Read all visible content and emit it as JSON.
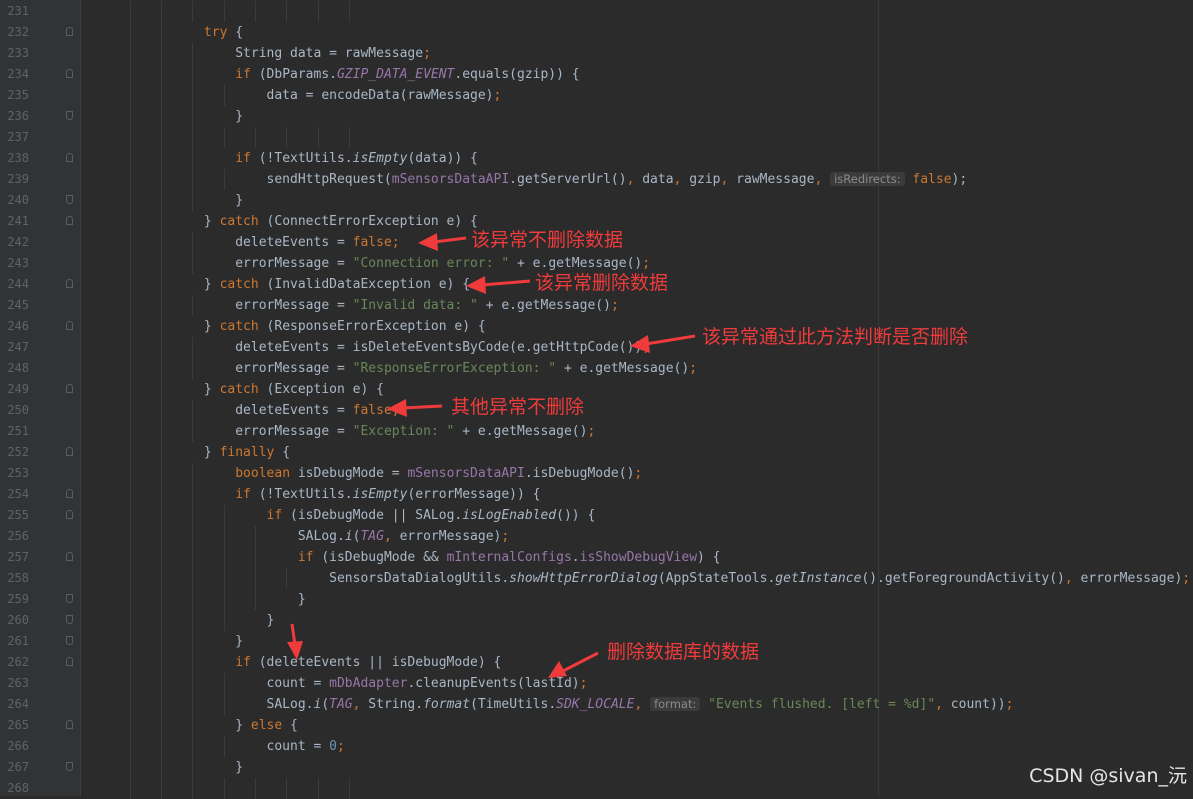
{
  "editor": {
    "lines": [
      {
        "n": "231",
        "fold": "",
        "segs": []
      },
      {
        "n": "232",
        "fold": "start",
        "segs": [
          [
            "            ",
            ""
          ],
          [
            "try",
            "kw"
          ],
          [
            " {",
            ""
          ]
        ]
      },
      {
        "n": "233",
        "fold": "",
        "segs": [
          [
            "                String data = rawMessage",
            ""
          ],
          [
            ";",
            "kw"
          ]
        ]
      },
      {
        "n": "234",
        "fold": "start",
        "segs": [
          [
            "                ",
            ""
          ],
          [
            "if",
            "kw"
          ],
          [
            " (DbParams.",
            ""
          ],
          [
            "GZIP_DATA_EVENT",
            "field ital"
          ],
          [
            ".equals(gzip)) {",
            ""
          ]
        ]
      },
      {
        "n": "235",
        "fold": "",
        "segs": [
          [
            "                    data = encodeData(rawMessage)",
            ""
          ],
          [
            ";",
            "kw"
          ]
        ]
      },
      {
        "n": "236",
        "fold": "end",
        "segs": [
          [
            "                }",
            ""
          ]
        ]
      },
      {
        "n": "237",
        "fold": "",
        "segs": []
      },
      {
        "n": "238",
        "fold": "start",
        "segs": [
          [
            "                ",
            ""
          ],
          [
            "if",
            "kw"
          ],
          [
            " (!TextUtils.",
            ""
          ],
          [
            "isEmpty",
            "ital"
          ],
          [
            "(data)) {",
            ""
          ]
        ]
      },
      {
        "n": "239",
        "fold": "",
        "segs": [
          [
            "                    sendHttpRequest(",
            ""
          ],
          [
            "mSensorsDataAPI",
            "field"
          ],
          [
            ".getServerUrl()",
            ""
          ],
          [
            ",",
            "kw"
          ],
          [
            " data",
            ""
          ],
          [
            ",",
            "kw"
          ],
          [
            " gzip",
            ""
          ],
          [
            ",",
            "kw"
          ],
          [
            " rawMessage",
            ""
          ],
          [
            ",",
            "kw"
          ],
          [
            " ",
            ""
          ],
          [
            "isRedirects:",
            "hint"
          ],
          [
            " ",
            ""
          ],
          [
            "false",
            "kw"
          ],
          [
            ");",
            ""
          ]
        ]
      },
      {
        "n": "240",
        "fold": "end",
        "segs": [
          [
            "                }",
            ""
          ]
        ]
      },
      {
        "n": "241",
        "fold": "start",
        "segs": [
          [
            "            } ",
            ""
          ],
          [
            "catch",
            "kw"
          ],
          [
            " (ConnectErrorException e) {",
            ""
          ]
        ]
      },
      {
        "n": "242",
        "fold": "",
        "segs": [
          [
            "                deleteEvents = ",
            ""
          ],
          [
            "false",
            "kw"
          ],
          [
            ";",
            "kw"
          ]
        ]
      },
      {
        "n": "243",
        "fold": "",
        "segs": [
          [
            "                errorMessage = ",
            ""
          ],
          [
            "\"Connection error: \"",
            "str"
          ],
          [
            " + e.getMessage()",
            ""
          ],
          [
            ";",
            "kw"
          ]
        ]
      },
      {
        "n": "244",
        "fold": "start",
        "segs": [
          [
            "            } ",
            ""
          ],
          [
            "catch",
            "kw"
          ],
          [
            " (InvalidDataException e) {",
            ""
          ]
        ]
      },
      {
        "n": "245",
        "fold": "",
        "segs": [
          [
            "                errorMessage = ",
            ""
          ],
          [
            "\"Invalid data: \"",
            "str"
          ],
          [
            " + e.getMessage()",
            ""
          ],
          [
            ";",
            "kw"
          ]
        ]
      },
      {
        "n": "246",
        "fold": "start",
        "segs": [
          [
            "            } ",
            ""
          ],
          [
            "catch",
            "kw"
          ],
          [
            " (ResponseErrorException e) {",
            ""
          ]
        ]
      },
      {
        "n": "247",
        "fold": "",
        "segs": [
          [
            "                deleteEvents = isDeleteEventsByCode(e.getHttpCode())",
            ""
          ],
          [
            ";",
            "kw"
          ]
        ]
      },
      {
        "n": "248",
        "fold": "",
        "segs": [
          [
            "                errorMessage = ",
            ""
          ],
          [
            "\"ResponseErrorException: \"",
            "str"
          ],
          [
            " + e.getMessage()",
            ""
          ],
          [
            ";",
            "kw"
          ]
        ]
      },
      {
        "n": "249",
        "fold": "start",
        "segs": [
          [
            "            } ",
            ""
          ],
          [
            "catch",
            "kw"
          ],
          [
            " (Exception e) {",
            ""
          ]
        ]
      },
      {
        "n": "250",
        "fold": "",
        "segs": [
          [
            "                deleteEvents = ",
            ""
          ],
          [
            "false",
            "kw"
          ],
          [
            ";",
            "kw"
          ]
        ]
      },
      {
        "n": "251",
        "fold": "",
        "segs": [
          [
            "                errorMessage = ",
            ""
          ],
          [
            "\"Exception: \"",
            "str"
          ],
          [
            " + e.getMessage()",
            ""
          ],
          [
            ";",
            "kw"
          ]
        ]
      },
      {
        "n": "252",
        "fold": "start",
        "segs": [
          [
            "            } ",
            ""
          ],
          [
            "finally",
            "kw"
          ],
          [
            " {",
            ""
          ]
        ]
      },
      {
        "n": "253",
        "fold": "",
        "segs": [
          [
            "                ",
            ""
          ],
          [
            "boolean",
            "kw"
          ],
          [
            " isDebugMode = ",
            ""
          ],
          [
            "mSensorsDataAPI",
            "field"
          ],
          [
            ".isDebugMode()",
            ""
          ],
          [
            ";",
            "kw"
          ]
        ]
      },
      {
        "n": "254",
        "fold": "start",
        "segs": [
          [
            "                ",
            ""
          ],
          [
            "if",
            "kw"
          ],
          [
            " (!TextUtils.",
            ""
          ],
          [
            "isEmpty",
            "ital"
          ],
          [
            "(errorMessage)) {",
            ""
          ]
        ]
      },
      {
        "n": "255",
        "fold": "start",
        "segs": [
          [
            "                    ",
            ""
          ],
          [
            "if",
            "kw"
          ],
          [
            " (isDebugMode || SALog.",
            ""
          ],
          [
            "isLogEnabled",
            "ital"
          ],
          [
            "()) {",
            ""
          ]
        ]
      },
      {
        "n": "256",
        "fold": "",
        "segs": [
          [
            "                        SALog.",
            ""
          ],
          [
            "i",
            "ital"
          ],
          [
            "(",
            ""
          ],
          [
            "TAG",
            "field ital"
          ],
          [
            ",",
            "kw"
          ],
          [
            " errorMessage)",
            ""
          ],
          [
            ";",
            "kw"
          ]
        ]
      },
      {
        "n": "257",
        "fold": "start",
        "segs": [
          [
            "                        ",
            ""
          ],
          [
            "if",
            "kw"
          ],
          [
            " (isDebugMode && ",
            ""
          ],
          [
            "mInternalConfigs",
            "field"
          ],
          [
            ".",
            ""
          ],
          [
            "isShowDebugView",
            "field"
          ],
          [
            ") {",
            ""
          ]
        ]
      },
      {
        "n": "258",
        "fold": "",
        "segs": [
          [
            "                            SensorsDataDialogUtils.",
            ""
          ],
          [
            "showHttpErrorDialog",
            "ital"
          ],
          [
            "(AppStateTools.",
            ""
          ],
          [
            "getInstance",
            "ital"
          ],
          [
            "().getForegroundActivity()",
            ""
          ],
          [
            ",",
            "kw"
          ],
          [
            " errorMessage)",
            ""
          ],
          [
            ";",
            "kw"
          ]
        ]
      },
      {
        "n": "259",
        "fold": "end",
        "segs": [
          [
            "                        }",
            ""
          ]
        ]
      },
      {
        "n": "260",
        "fold": "end",
        "segs": [
          [
            "                    }",
            ""
          ]
        ]
      },
      {
        "n": "261",
        "fold": "end",
        "segs": [
          [
            "                }",
            ""
          ]
        ]
      },
      {
        "n": "262",
        "fold": "start",
        "segs": [
          [
            "                ",
            ""
          ],
          [
            "if",
            "kw"
          ],
          [
            " (deleteEvents || isDebugMode) {",
            ""
          ]
        ]
      },
      {
        "n": "263",
        "fold": "",
        "segs": [
          [
            "                    count = ",
            ""
          ],
          [
            "mDbAdapter",
            "field"
          ],
          [
            ".cleanupEvents(lastId)",
            ""
          ],
          [
            ";",
            "kw"
          ]
        ]
      },
      {
        "n": "264",
        "fold": "",
        "segs": [
          [
            "                    SALog.",
            ""
          ],
          [
            "i",
            "ital"
          ],
          [
            "(",
            ""
          ],
          [
            "TAG",
            "field ital"
          ],
          [
            ",",
            "kw"
          ],
          [
            " String.",
            ""
          ],
          [
            "format",
            "ital"
          ],
          [
            "(TimeUtils.",
            ""
          ],
          [
            "SDK_LOCALE",
            "field ital"
          ],
          [
            ",",
            "kw"
          ],
          [
            " ",
            ""
          ],
          [
            "format:",
            "hint"
          ],
          [
            " ",
            ""
          ],
          [
            "\"Events flushed. [left = %d]\"",
            "str"
          ],
          [
            ",",
            "kw"
          ],
          [
            " count))",
            ""
          ],
          [
            ";",
            "kw"
          ]
        ]
      },
      {
        "n": "265",
        "fold": "start",
        "segs": [
          [
            "                } ",
            ""
          ],
          [
            "else",
            "kw"
          ],
          [
            " {",
            ""
          ]
        ]
      },
      {
        "n": "266",
        "fold": "",
        "segs": [
          [
            "                    count = ",
            ""
          ],
          [
            "0",
            "num"
          ],
          [
            ";",
            "kw"
          ]
        ]
      },
      {
        "n": "267",
        "fold": "end",
        "segs": [
          [
            "                }",
            ""
          ]
        ]
      },
      {
        "n": "268",
        "fold": "",
        "segs": []
      }
    ]
  },
  "annotations": {
    "a1": "该异常不删除数据",
    "a2": "该异常删除数据",
    "a3": "该异常通过此方法判断是否删除",
    "a4": "其他异常不删除",
    "a5": "删除数据库的数据"
  },
  "colors": {
    "background": "#2b2b2b",
    "annotation": "#ef3b3b"
  },
  "watermark": "CSDN @sivan_沅"
}
